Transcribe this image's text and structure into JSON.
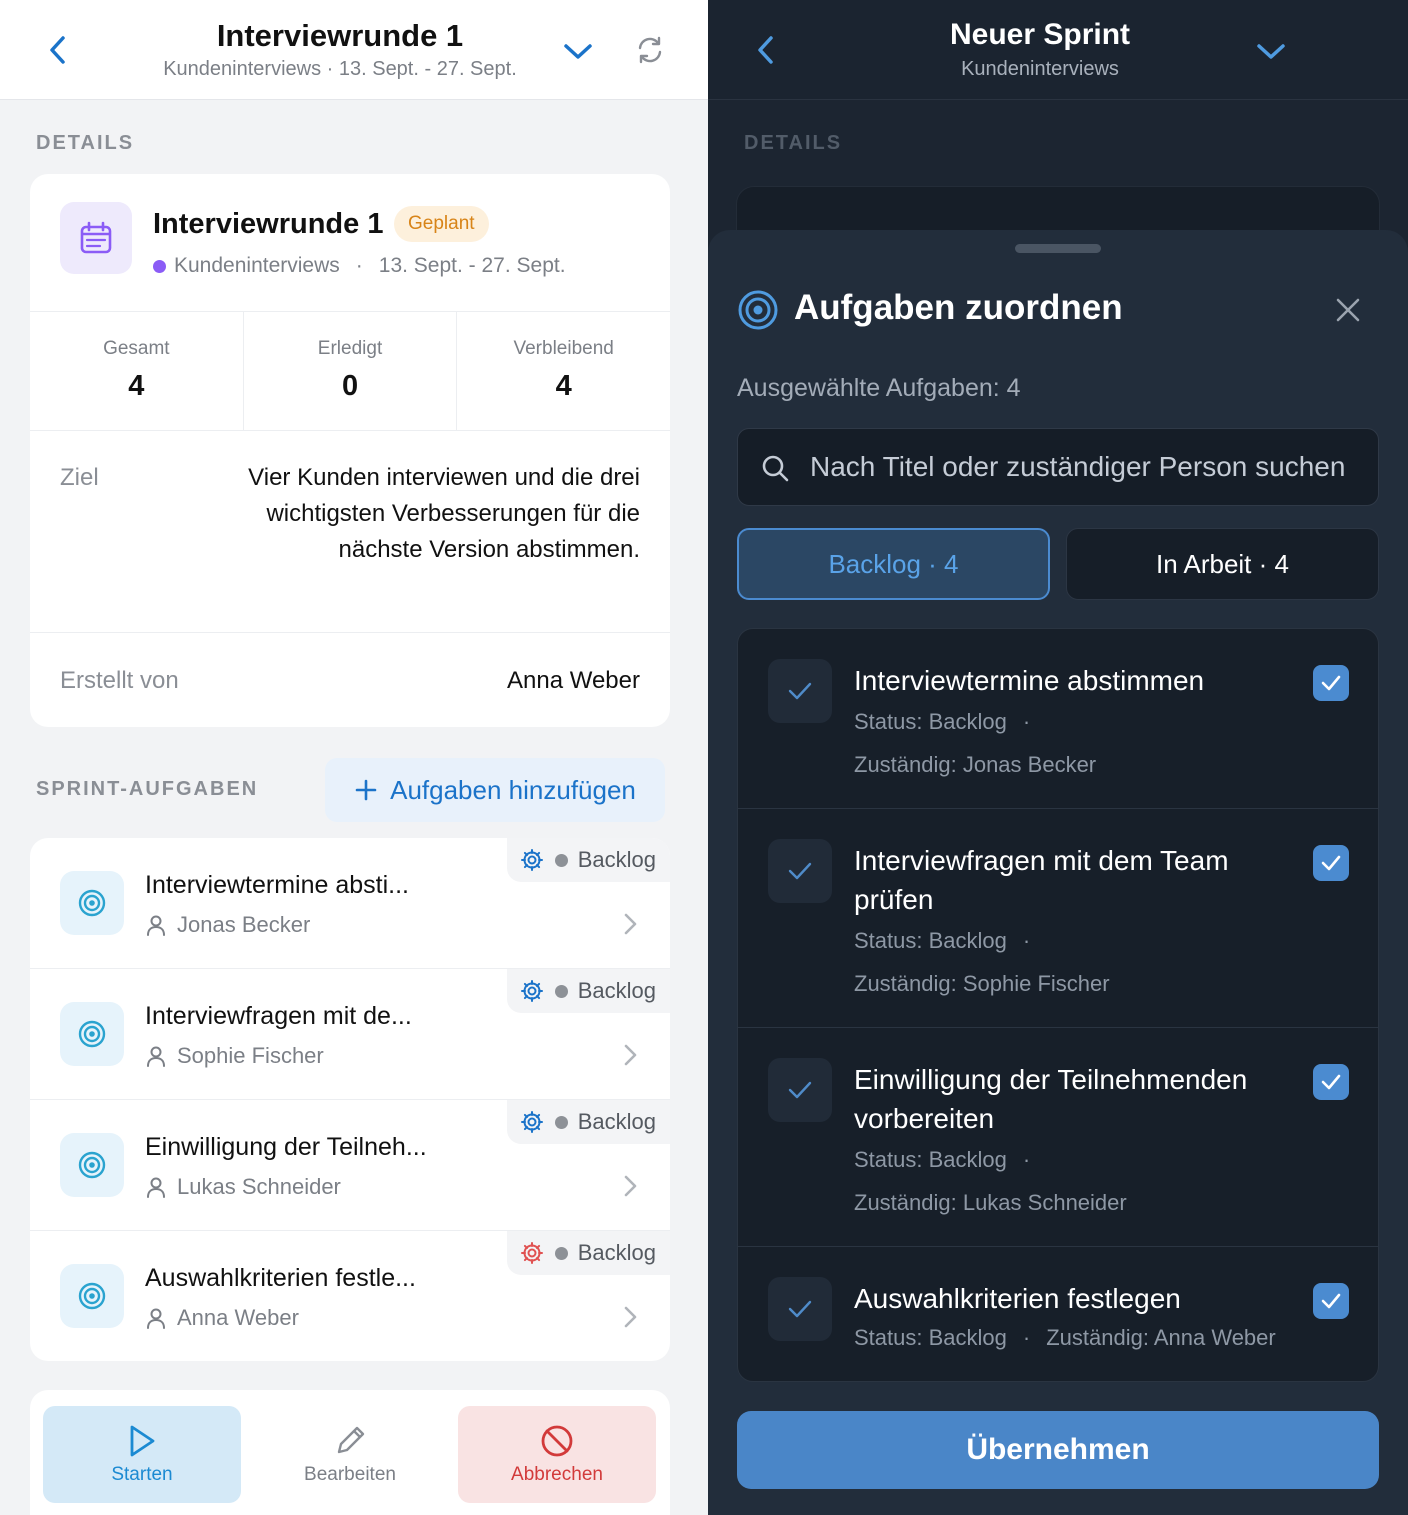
{
  "left": {
    "header": {
      "title": "Interviewrunde 1",
      "subtitle": "Kundeninterviews · 13. Sept. - 27. Sept."
    },
    "details_label": "DETAILS",
    "sprint": {
      "title": "Interviewrunde 1",
      "badge": "Geplant",
      "project": "Kundeninterviews",
      "separator": "·",
      "dates": "13. Sept. - 27. Sept.",
      "stats": [
        {
          "label": "Gesamt",
          "value": "4"
        },
        {
          "label": "Erledigt",
          "value": "0"
        },
        {
          "label": "Verbleibend",
          "value": "4"
        }
      ],
      "goal_label": "Ziel",
      "goal_text": "Vier Kunden interviewen und die drei wichtigsten Verbesserungen für die nächste Version abstimmen.",
      "creator_label": "Erstellt von",
      "creator_value": "Anna Weber"
    },
    "tasks_label": "SPRINT-AUFGABEN",
    "add_tasks_label": "Aufgaben hinzufügen",
    "tasks": [
      {
        "title": "Interviewtermine absti...",
        "person": "Jonas Becker",
        "status": "Backlog",
        "priority_color": "#1b73c9"
      },
      {
        "title": "Interviewfragen mit de...",
        "person": "Sophie Fischer",
        "status": "Backlog",
        "priority_color": "#1b73c9"
      },
      {
        "title": "Einwilligung der Teilneh...",
        "person": "Lukas Schneider",
        "status": "Backlog",
        "priority_color": "#1b73c9"
      },
      {
        "title": "Auswahlkriterien festle...",
        "person": "Anna Weber",
        "status": "Backlog",
        "priority_color": "#e05252"
      }
    ],
    "actions": {
      "start": "Starten",
      "edit": "Bearbeiten",
      "cancel": "Abbrechen"
    }
  },
  "right": {
    "header": {
      "title": "Neuer Sprint",
      "subtitle": "Kundeninterviews"
    },
    "details_label": "DETAILS",
    "sheet": {
      "title": "Aufgaben zuordnen",
      "selected_count": "Ausgewählte Aufgaben: 4",
      "search_placeholder": "Nach Titel oder zuständiger Person suchen",
      "tabs": [
        {
          "label": "Backlog · 4",
          "active": true
        },
        {
          "label": "In Arbeit · 4",
          "active": false
        }
      ],
      "items": [
        {
          "title": "Interviewtermine abstimmen",
          "status": "Status: Backlog",
          "separator": "·",
          "assignee": "Zuständig: Jonas Becker",
          "checked": true
        },
        {
          "title": "Interviewfragen mit dem Team prüfen",
          "status": "Status: Backlog",
          "separator": "·",
          "assignee": "Zuständig: Sophie Fischer",
          "checked": true
        },
        {
          "title": "Einwilligung der Teilnehmenden vorbereiten",
          "status": "Status: Backlog",
          "separator": "·",
          "assignee": "Zuständig: Lukas Schneider",
          "checked": true
        },
        {
          "title": "Auswahlkriterien festlegen",
          "status": "Status: Backlog",
          "separator": "·",
          "assignee": "Zuständig: Anna Weber",
          "checked": true
        }
      ],
      "apply_label": "Übernehmen"
    }
  },
  "colors": {
    "accent_blue": "#1b73c9",
    "badge_orange": "#d88418",
    "danger_red": "#d23a3a",
    "dark_bg": "#1c2531",
    "checkbox_blue": "#4b8bd0"
  }
}
